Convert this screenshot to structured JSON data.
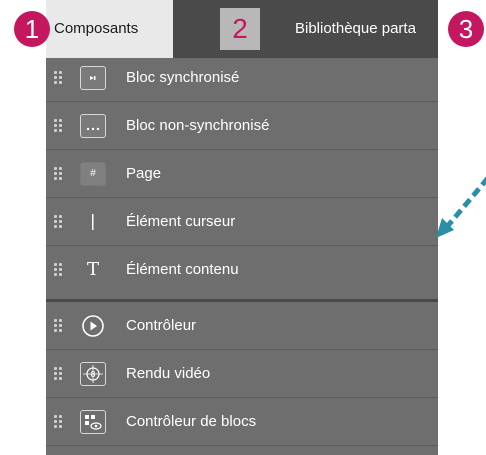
{
  "tabs": [
    {
      "label": "Composants"
    },
    {
      "label": "hèque"
    },
    {
      "label": "Bibliothèque parta"
    }
  ],
  "markers": [
    "1",
    "2",
    "3"
  ],
  "items": [
    {
      "label": "Bloc synchronisé",
      "icon": "sync-block-icon"
    },
    {
      "label": "Bloc non-synchronisé",
      "icon": "non-sync-block-icon"
    },
    {
      "label": "Page",
      "icon": "hash-icon",
      "glyph": "#"
    },
    {
      "label": "Élément curseur",
      "icon": "cursor-icon"
    },
    {
      "label": "Élément contenu",
      "icon": "text-icon",
      "glyph": "T"
    },
    {
      "label": "Contrôleur",
      "icon": "play-icon"
    },
    {
      "label": "Rendu vidéo",
      "icon": "video-render-icon"
    },
    {
      "label": "Contrôleur de blocs",
      "icon": "block-controller-icon"
    }
  ],
  "colors": {
    "marker": "#c4175f",
    "arrow": "#2a8fa6",
    "panel": "#6e6e6e",
    "tabbar": "#4a4a4a"
  }
}
